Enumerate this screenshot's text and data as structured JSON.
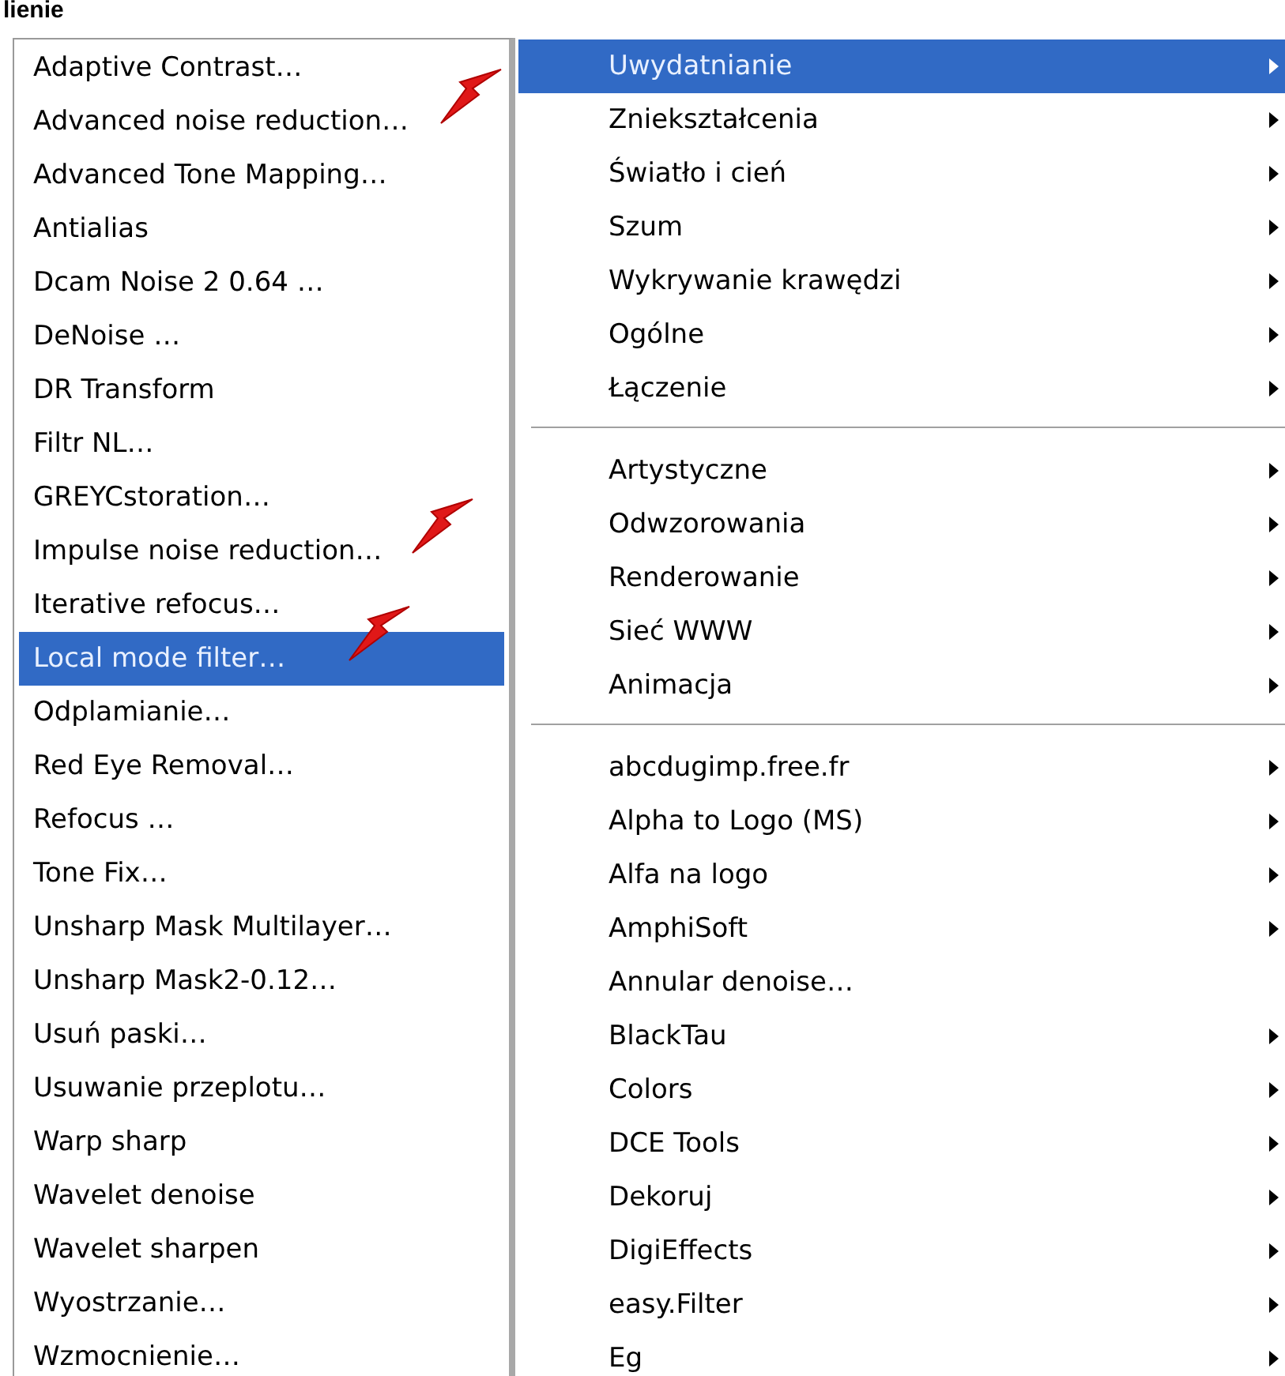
{
  "header": {
    "title": "lienie"
  },
  "submenu": {
    "items": [
      {
        "label": "Adaptive Contrast…",
        "selected": false,
        "marked": false
      },
      {
        "label": "Advanced noise reduction…",
        "selected": false,
        "marked": true
      },
      {
        "label": "Advanced Tone Mapping…",
        "selected": false,
        "marked": false
      },
      {
        "label": "Antialias",
        "selected": false,
        "marked": false
      },
      {
        "label": "Dcam Noise 2 0.64 …",
        "selected": false,
        "marked": false
      },
      {
        "label": "DeNoise …",
        "selected": false,
        "marked": false
      },
      {
        "label": "DR Transform",
        "selected": false,
        "marked": false
      },
      {
        "label": "Filtr NL…",
        "selected": false,
        "marked": false
      },
      {
        "label": "GREYCstoration…",
        "selected": false,
        "marked": false
      },
      {
        "label": "Impulse noise reduction…",
        "selected": false,
        "marked": true
      },
      {
        "label": "Iterative refocus…",
        "selected": false,
        "marked": false
      },
      {
        "label": "Local mode filter…",
        "selected": true,
        "marked": true
      },
      {
        "label": "Odplamianie…",
        "selected": false,
        "marked": false
      },
      {
        "label": "Red Eye Removal…",
        "selected": false,
        "marked": false
      },
      {
        "label": "Refocus …",
        "selected": false,
        "marked": false
      },
      {
        "label": "Tone Fix…",
        "selected": false,
        "marked": false
      },
      {
        "label": "Unsharp Mask Multilayer…",
        "selected": false,
        "marked": false
      },
      {
        "label": "Unsharp Mask2-0.12…",
        "selected": false,
        "marked": false
      },
      {
        "label": "Usuń paski…",
        "selected": false,
        "marked": false
      },
      {
        "label": "Usuwanie przeplotu…",
        "selected": false,
        "marked": false
      },
      {
        "label": "Warp sharp",
        "selected": false,
        "marked": false
      },
      {
        "label": "Wavelet denoise",
        "selected": false,
        "marked": false
      },
      {
        "label": "Wavelet sharpen",
        "selected": false,
        "marked": false
      },
      {
        "label": "Wyostrzanie…",
        "selected": false,
        "marked": false
      },
      {
        "label": "Wzmocnienie…",
        "selected": false,
        "marked": false
      }
    ]
  },
  "menu": {
    "items": [
      {
        "kind": "item",
        "label": "Uwydatnianie",
        "selected": true,
        "has_submenu": true
      },
      {
        "kind": "item",
        "label": "Zniekształcenia",
        "selected": false,
        "has_submenu": true
      },
      {
        "kind": "item",
        "label": "Światło i cień",
        "selected": false,
        "has_submenu": true
      },
      {
        "kind": "item",
        "label": "Szum",
        "selected": false,
        "has_submenu": true
      },
      {
        "kind": "item",
        "label": "Wykrywanie krawędzi",
        "selected": false,
        "has_submenu": true
      },
      {
        "kind": "item",
        "label": "Ogólne",
        "selected": false,
        "has_submenu": true
      },
      {
        "kind": "item",
        "label": "Łączenie",
        "selected": false,
        "has_submenu": true
      },
      {
        "kind": "separator"
      },
      {
        "kind": "item",
        "label": "Artystyczne",
        "selected": false,
        "has_submenu": true
      },
      {
        "kind": "item",
        "label": "Odwzorowania",
        "selected": false,
        "has_submenu": true
      },
      {
        "kind": "item",
        "label": "Renderowanie",
        "selected": false,
        "has_submenu": true
      },
      {
        "kind": "item",
        "label": "Sieć WWW",
        "selected": false,
        "has_submenu": true
      },
      {
        "kind": "item",
        "label": "Animacja",
        "selected": false,
        "has_submenu": true
      },
      {
        "kind": "separator"
      },
      {
        "kind": "item",
        "label": "abcdugimp.free.fr",
        "selected": false,
        "has_submenu": true
      },
      {
        "kind": "item",
        "label": "Alpha to Logo (MS)",
        "selected": false,
        "has_submenu": true
      },
      {
        "kind": "item",
        "label": "Alfa na logo",
        "selected": false,
        "has_submenu": true
      },
      {
        "kind": "item",
        "label": "AmphiSoft",
        "selected": false,
        "has_submenu": true
      },
      {
        "kind": "item",
        "label": "Annular denoise…",
        "selected": false,
        "has_submenu": false
      },
      {
        "kind": "item",
        "label": "BlackTau",
        "selected": false,
        "has_submenu": true
      },
      {
        "kind": "item",
        "label": "Colors",
        "selected": false,
        "has_submenu": true
      },
      {
        "kind": "item",
        "label": "DCE Tools",
        "selected": false,
        "has_submenu": true
      },
      {
        "kind": "item",
        "label": "Dekoruj",
        "selected": false,
        "has_submenu": true
      },
      {
        "kind": "item",
        "label": "DigiEffects",
        "selected": false,
        "has_submenu": true
      },
      {
        "kind": "item",
        "label": "easy.Filter",
        "selected": false,
        "has_submenu": true
      },
      {
        "kind": "item",
        "label": "Eg",
        "selected": false,
        "has_submenu": true
      }
    ]
  }
}
